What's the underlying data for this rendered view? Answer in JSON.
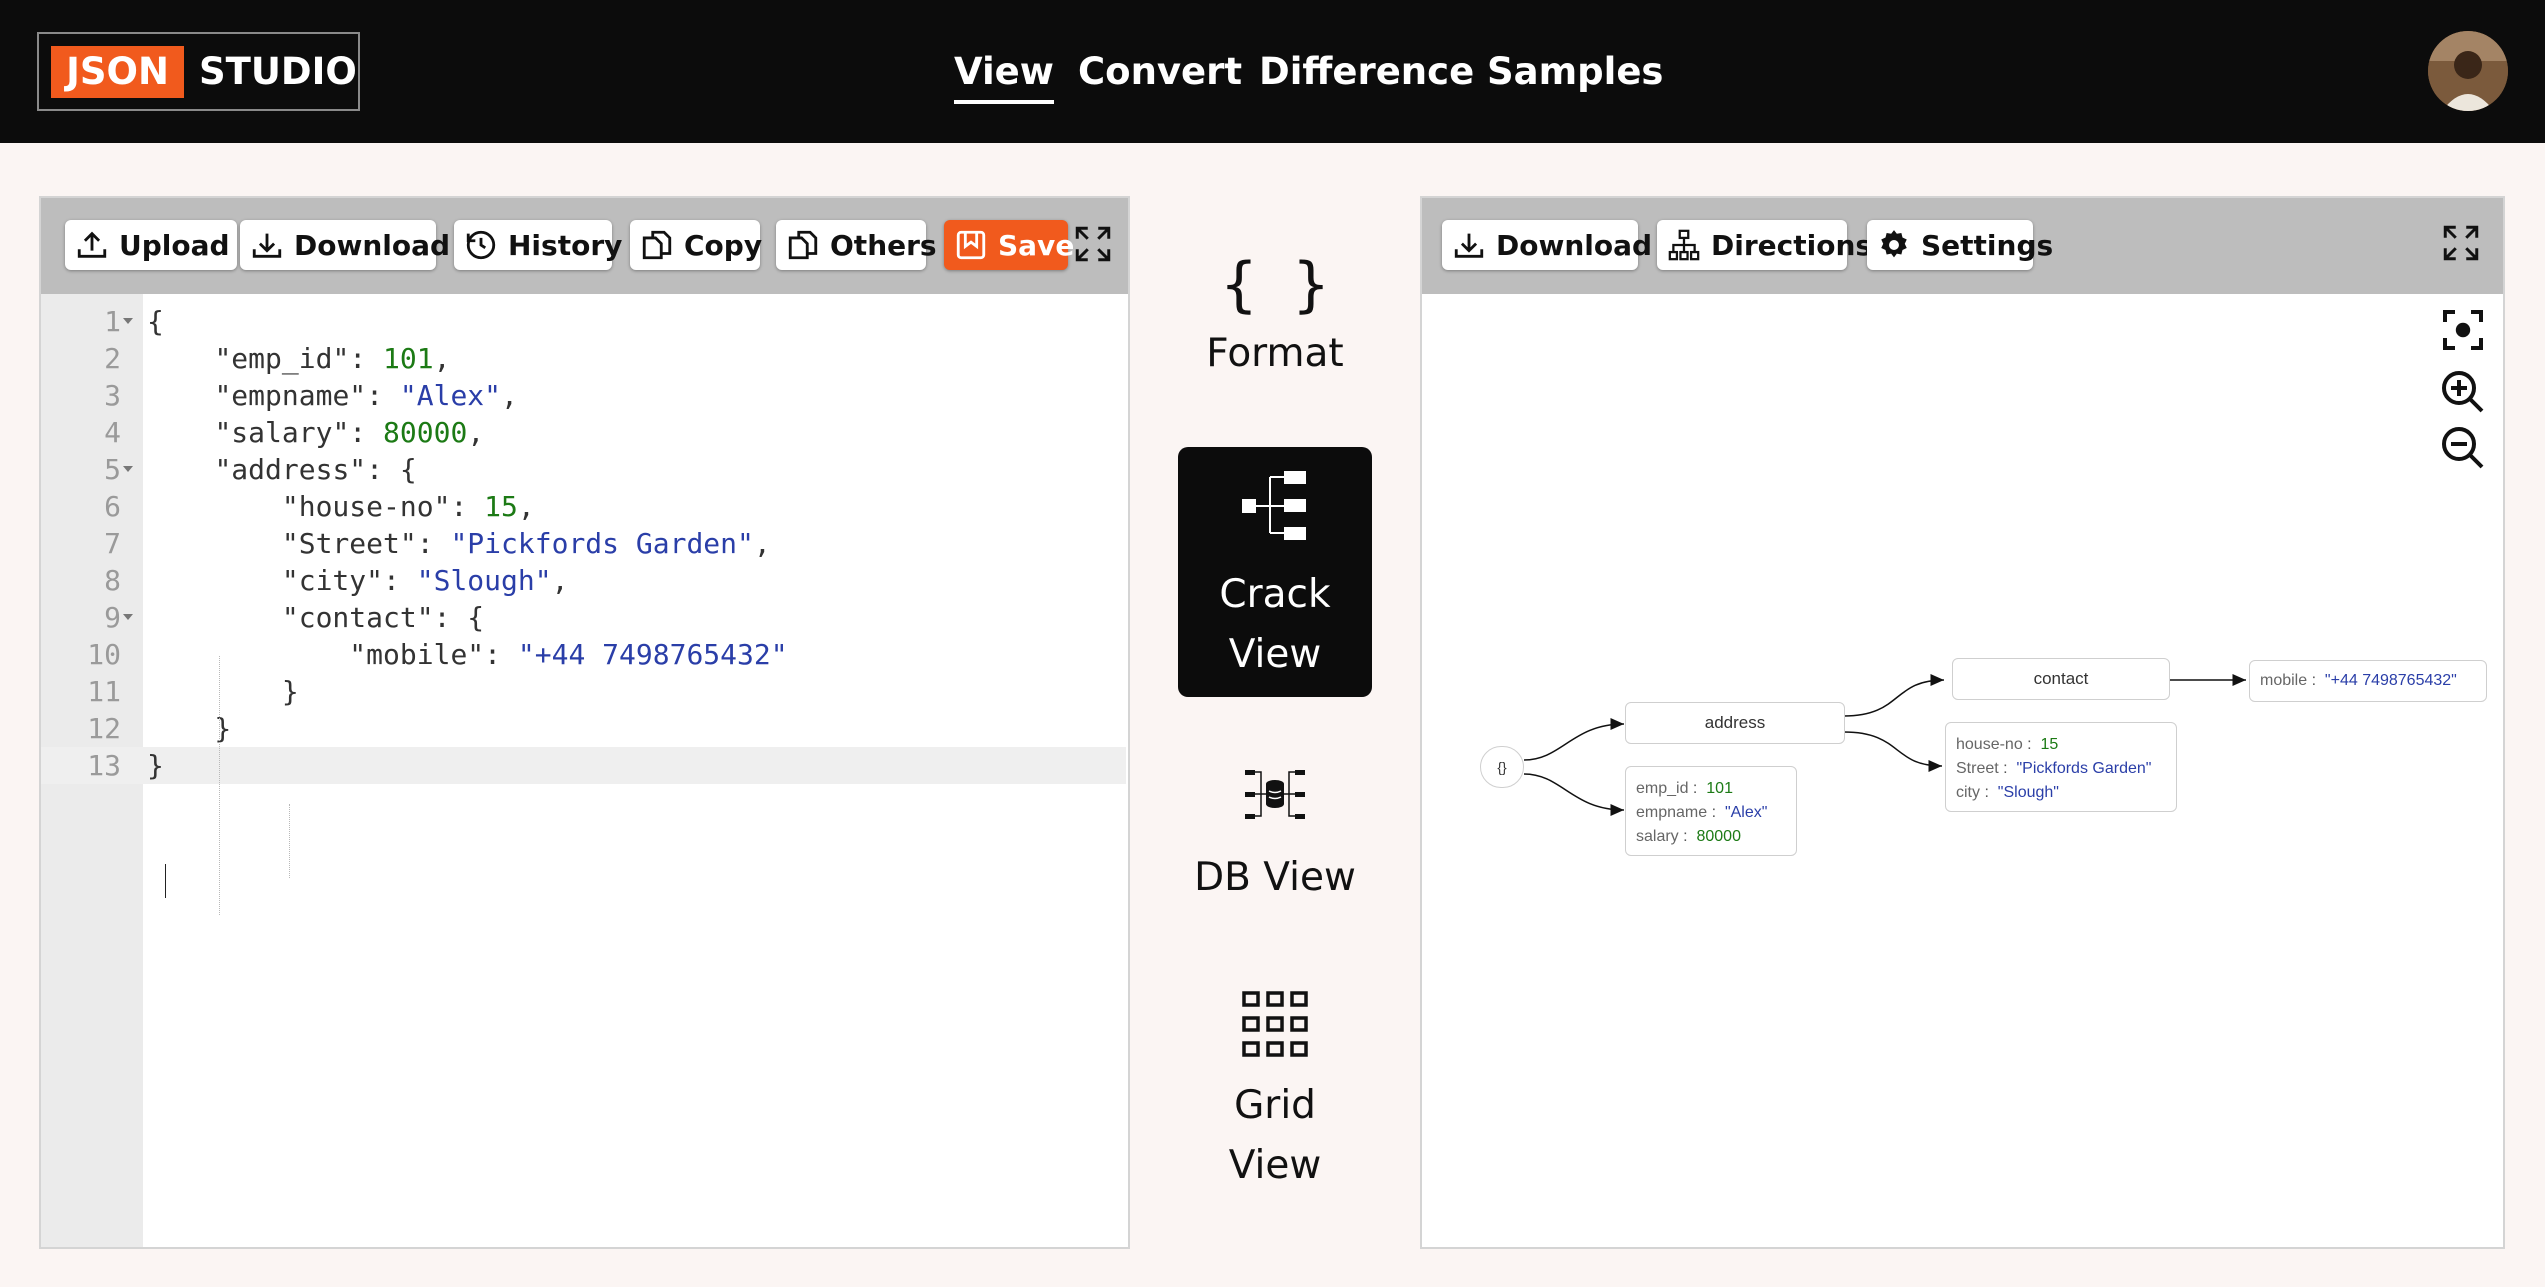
{
  "header": {
    "logo_json": "JSON",
    "logo_studio": "STUDIO",
    "nav": [
      "View",
      "Convert",
      "Difference",
      "Samples"
    ],
    "active_nav": "View"
  },
  "editor_toolbar": {
    "upload": "Upload",
    "download": "Download",
    "history": "History",
    "copy": "Copy",
    "others": "Others",
    "save": "Save"
  },
  "editor": {
    "active_line": 13,
    "folded_lines": [
      1,
      5,
      9
    ],
    "lines": [
      [
        {
          "t": "p",
          "v": "{"
        }
      ],
      [
        {
          "t": "p",
          "v": "    "
        },
        {
          "t": "k",
          "v": "\"emp_id\""
        },
        {
          "t": "p",
          "v": ": "
        },
        {
          "t": "n",
          "v": "101"
        },
        {
          "t": "p",
          "v": ","
        }
      ],
      [
        {
          "t": "p",
          "v": "    "
        },
        {
          "t": "k",
          "v": "\"empname\""
        },
        {
          "t": "p",
          "v": ": "
        },
        {
          "t": "s",
          "v": "\"Alex\""
        },
        {
          "t": "p",
          "v": ","
        }
      ],
      [
        {
          "t": "p",
          "v": "    "
        },
        {
          "t": "k",
          "v": "\"salary\""
        },
        {
          "t": "p",
          "v": ": "
        },
        {
          "t": "n",
          "v": "80000"
        },
        {
          "t": "p",
          "v": ","
        }
      ],
      [
        {
          "t": "p",
          "v": "    "
        },
        {
          "t": "k",
          "v": "\"address\""
        },
        {
          "t": "p",
          "v": ": {"
        }
      ],
      [
        {
          "t": "p",
          "v": "        "
        },
        {
          "t": "k",
          "v": "\"house-no\""
        },
        {
          "t": "p",
          "v": ": "
        },
        {
          "t": "n",
          "v": "15"
        },
        {
          "t": "p",
          "v": ","
        }
      ],
      [
        {
          "t": "p",
          "v": "        "
        },
        {
          "t": "k",
          "v": "\"Street\""
        },
        {
          "t": "p",
          "v": ": "
        },
        {
          "t": "s",
          "v": "\"Pickfords Garden\""
        },
        {
          "t": "p",
          "v": ","
        }
      ],
      [
        {
          "t": "p",
          "v": "        "
        },
        {
          "t": "k",
          "v": "\"city\""
        },
        {
          "t": "p",
          "v": ": "
        },
        {
          "t": "s",
          "v": "\"Slough\""
        },
        {
          "t": "p",
          "v": ","
        }
      ],
      [
        {
          "t": "p",
          "v": "        "
        },
        {
          "t": "k",
          "v": "\"contact\""
        },
        {
          "t": "p",
          "v": ": {"
        }
      ],
      [
        {
          "t": "p",
          "v": "            "
        },
        {
          "t": "k",
          "v": "\"mobile\""
        },
        {
          "t": "p",
          "v": ": "
        },
        {
          "t": "s",
          "v": "\"+44 7498765432\""
        }
      ],
      [
        {
          "t": "p",
          "v": "        }"
        }
      ],
      [
        {
          "t": "p",
          "v": "    }"
        }
      ],
      [
        {
          "t": "p",
          "v": "}"
        }
      ]
    ]
  },
  "middle": {
    "format": "Format",
    "crack_view": [
      "Crack",
      "View"
    ],
    "db_view": "DB View",
    "grid_view": [
      "Grid",
      "View"
    ],
    "icons": [
      "curly-braces-icon",
      "tree-icon",
      "database-icon",
      "grid-icon"
    ]
  },
  "graph_toolbar": {
    "download": "Download",
    "directions": "Directions",
    "settings": "Settings"
  },
  "graph": {
    "root": "{}",
    "address": "address",
    "contact": "contact",
    "emp_node": [
      {
        "key": "emp_id",
        "value": "101",
        "kind": "n"
      },
      {
        "key": "empname",
        "value": "\"Alex\"",
        "kind": "s"
      },
      {
        "key": "salary",
        "value": "80000",
        "kind": "n"
      }
    ],
    "address_node": [
      {
        "key": "house-no",
        "value": "15",
        "kind": "n"
      },
      {
        "key": "Street",
        "value": "\"Pickfords Garden\"",
        "kind": "s"
      },
      {
        "key": "city",
        "value": "\"Slough\"",
        "kind": "s"
      }
    ],
    "mobile_node": [
      {
        "key": "mobile",
        "value": "\"+44 7498765432\"",
        "kind": "s"
      }
    ]
  },
  "colors": {
    "brand": "#f15a1d",
    "header_bg": "#0c0c0c",
    "string": "#2a3ea8",
    "number": "#1c7a15"
  }
}
